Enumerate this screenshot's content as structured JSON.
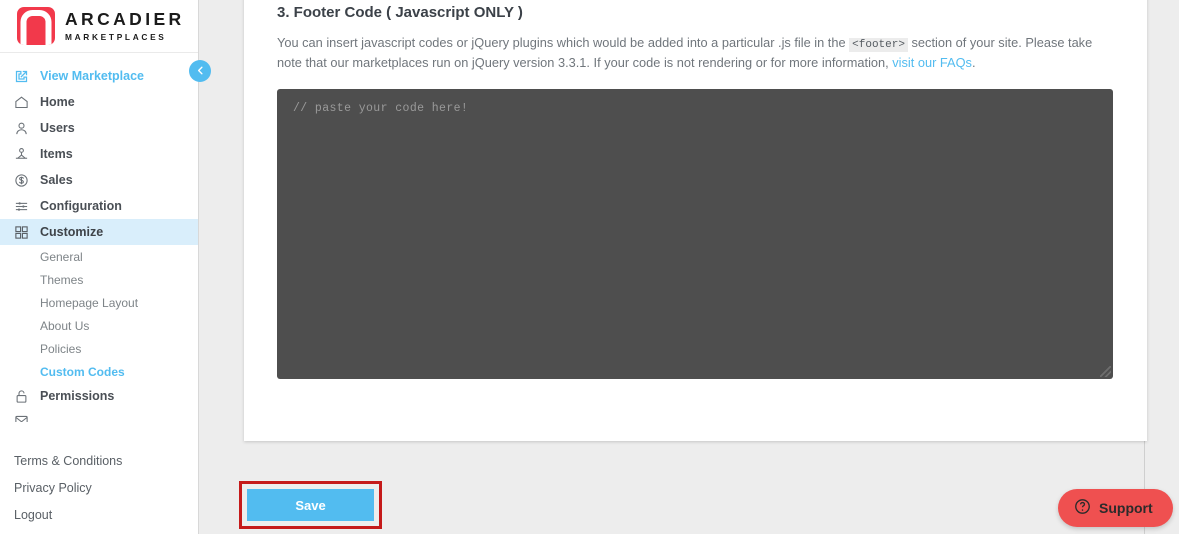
{
  "brand": {
    "name": "ARCADIER",
    "tagline": "MARKETPLACES",
    "logo_color": "#f2394b"
  },
  "colors": {
    "accent_blue": "#52bcf0",
    "active_nav_bg": "#d9eefb",
    "annotation_red": "#c51a1a",
    "support_red": "#ef5050",
    "editor_bg": "#4e4e4e"
  },
  "sidebar": {
    "collapse_icon": "chevron-left-icon",
    "view_marketplace": {
      "label": "View Marketplace",
      "icon": "external-link-icon"
    },
    "items": [
      {
        "label": "Home",
        "icon": "home-icon"
      },
      {
        "label": "Users",
        "icon": "user-icon"
      },
      {
        "label": "Items",
        "icon": "items-icon"
      },
      {
        "label": "Sales",
        "icon": "dollar-circle-icon"
      },
      {
        "label": "Configuration",
        "icon": "sliders-icon"
      },
      {
        "label": "Customize",
        "icon": "grid-icon"
      }
    ],
    "sub_items": [
      {
        "label": "General"
      },
      {
        "label": "Themes"
      },
      {
        "label": "Homepage Layout"
      },
      {
        "label": "About Us"
      },
      {
        "label": "Policies"
      },
      {
        "label": "Custom Codes"
      }
    ],
    "items_after": [
      {
        "label": "Permissions",
        "icon": "lock-icon"
      }
    ],
    "footer_links": [
      {
        "label": "Terms & Conditions"
      },
      {
        "label": "Privacy Policy"
      },
      {
        "label": "Logout"
      }
    ]
  },
  "main": {
    "section_title": "3. Footer Code ( Javascript ONLY )",
    "description_part1": "You can insert javascript codes or jQuery plugins which would be added into a particular .js file in the ",
    "description_code": "<footer>",
    "description_part2": " section of your site. Please take note that our marketplaces run on jQuery version 3.3.1. If your code is not rendering or for more information, ",
    "description_link": "visit our FAQs",
    "description_part3": ".",
    "editor_placeholder": "// paste your code here!",
    "editor_value": "",
    "save_label": "Save"
  },
  "support": {
    "label": "Support",
    "icon": "question-circle-icon"
  }
}
